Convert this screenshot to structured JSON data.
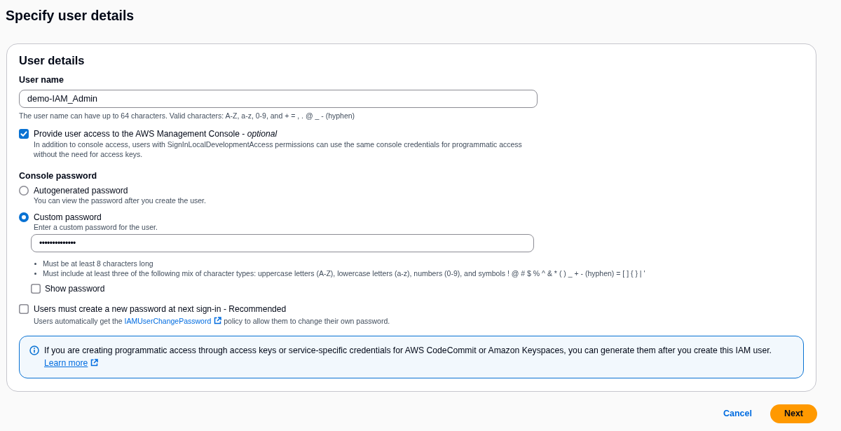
{
  "page_title": "Specify user details",
  "user_details": {
    "heading": "User details",
    "user_name": {
      "label": "User name",
      "value": "demo-IAM_Admin",
      "hint": "The user name can have up to 64 characters. Valid characters: A-Z, a-z, 0-9, and + = , . @ _ - (hyphen)"
    },
    "console_access": {
      "label": "Provide user access to the AWS Management Console - *optional*",
      "checked": true,
      "description": "In addition to console access, users with SignInLocalDevelopmentAccess permissions can use the same console credentials for programmatic access without the need for access keys."
    },
    "console_password": {
      "label": "Console password",
      "options": [
        {
          "label": "Autogenerated password",
          "description": "You can view the password after you create the user.",
          "selected": false
        },
        {
          "label": "Custom password",
          "description": "Enter a custom password for the user.",
          "selected": true
        }
      ],
      "password_field": {
        "value": "••••••••••••••",
        "requirements": [
          "Must be at least 8 characters long",
          "Must include at least three of the following mix of character types: uppercase letters (A-Z), lowercase letters (a-z), numbers (0-9), and symbols ! @ # $ % ^ & * ( ) _ + - (hyphen) = [ ] { } | '"
        ]
      },
      "show_password": {
        "label": "Show password",
        "checked": false
      }
    },
    "reset_required": {
      "label": "Users must create a new password at next sign-in - Recommended",
      "checked": false,
      "description": {
        "before": "Users automatically get the",
        "link": "IAMUserChangePassword",
        "after": "policy to allow them to change their own password."
      }
    },
    "info_alert": {
      "text": "If you are creating programmatic access through access keys or service-specific credentials for AWS CodeCommit or Amazon Keyspaces, you can generate them after you create this IAM user.",
      "link": "Learn more"
    }
  },
  "actions": [
    {
      "label": "Cancel",
      "kind": "link"
    },
    {
      "label": "Next",
      "kind": "primary"
    }
  ]
}
